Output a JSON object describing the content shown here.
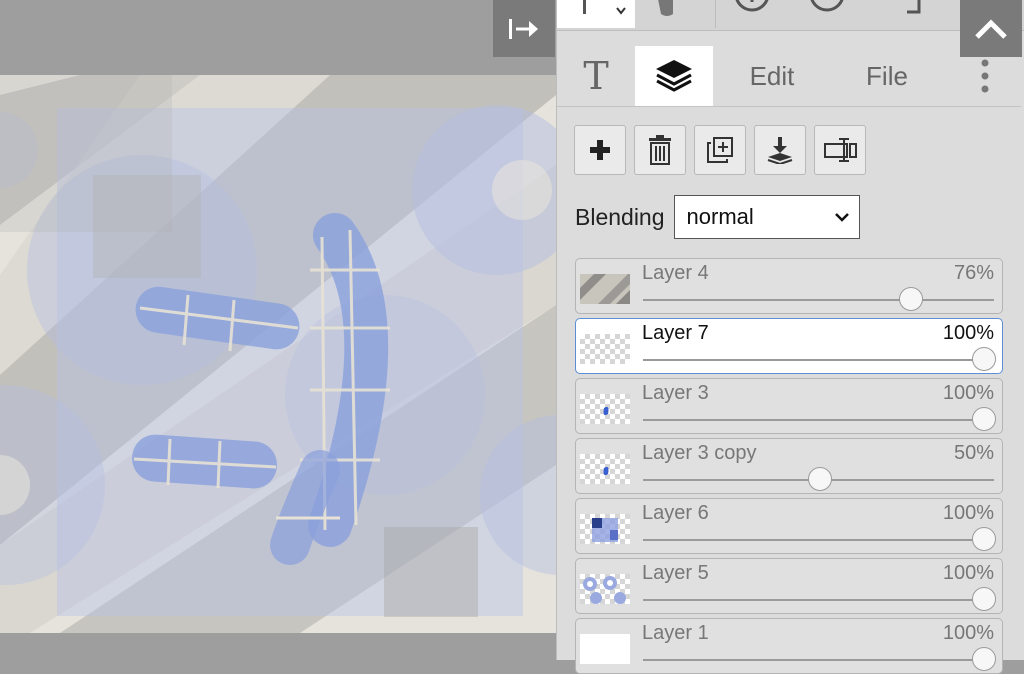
{
  "panel": {
    "tabs": [
      {
        "name": "text-tab",
        "label": "T"
      },
      {
        "name": "layers-tab",
        "label": "",
        "active": true
      },
      {
        "name": "edit-tab",
        "label": "Edit"
      },
      {
        "name": "file-tab",
        "label": "File"
      }
    ]
  },
  "layer_toolbar": {
    "buttons": [
      "add-layer-icon",
      "delete-layer-icon",
      "duplicate-layer-icon",
      "merge-down-icon",
      "layer-properties-icon"
    ]
  },
  "blending": {
    "label": "Blending",
    "value": "normal"
  },
  "layers": [
    {
      "name": "Layer 4",
      "opacity_label": "76%",
      "opacity": 0.76,
      "selected": false,
      "thumb": "stripes"
    },
    {
      "name": "Layer 7",
      "opacity_label": "100%",
      "opacity": 1.0,
      "selected": true,
      "thumb": "checker"
    },
    {
      "name": "Layer 3",
      "opacity_label": "100%",
      "opacity": 1.0,
      "selected": false,
      "thumb": "checker-dot"
    },
    {
      "name": "Layer 3 copy",
      "opacity_label": "50%",
      "opacity": 0.5,
      "selected": false,
      "thumb": "checker-dot"
    },
    {
      "name": "Layer 6",
      "opacity_label": "100%",
      "opacity": 1.0,
      "selected": false,
      "thumb": "checker-blue"
    },
    {
      "name": "Layer 5",
      "opacity_label": "100%",
      "opacity": 1.0,
      "selected": false,
      "thumb": "checker-circles"
    },
    {
      "name": "Layer 1",
      "opacity_label": "100%",
      "opacity": 1.0,
      "selected": false,
      "thumb": "white"
    }
  ],
  "colors": {
    "accent": "#5b8fd6",
    "panel_bg": "#dcdcdc",
    "canvas_bg": "#9e9e9e"
  }
}
